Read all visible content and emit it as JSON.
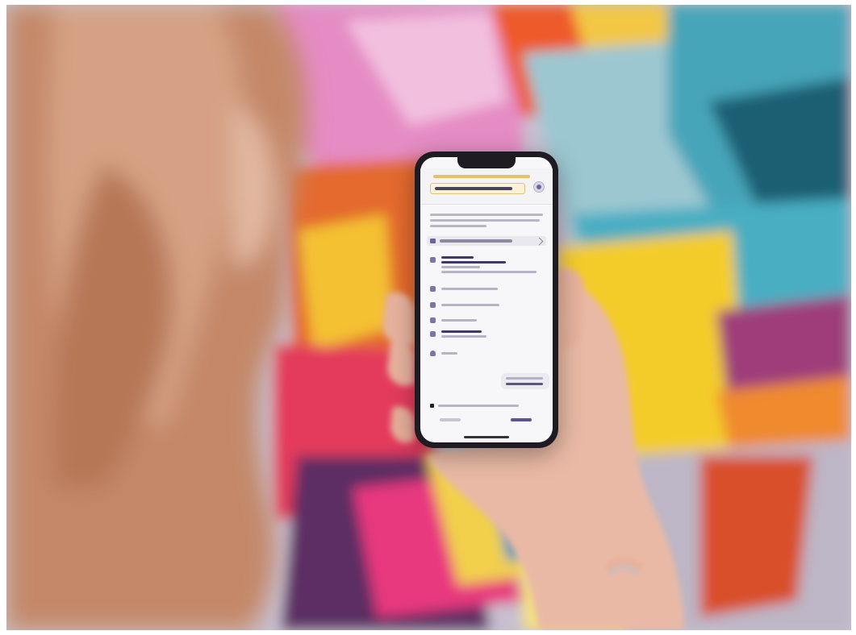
{
  "scene": {
    "description_colors": {
      "hair": "#c4866a",
      "skin": "#e8b8a4",
      "mural_pink": "#e07ab6",
      "mural_teal": "#3e9fb4",
      "mural_yellow": "#f3c533",
      "mural_red": "#e34a2a",
      "phone_body": "#1e1b22",
      "screen_bg": "#f7f7f9",
      "accent": "#5b5490"
    }
  },
  "phone": {
    "screen_text_legible": false
  }
}
